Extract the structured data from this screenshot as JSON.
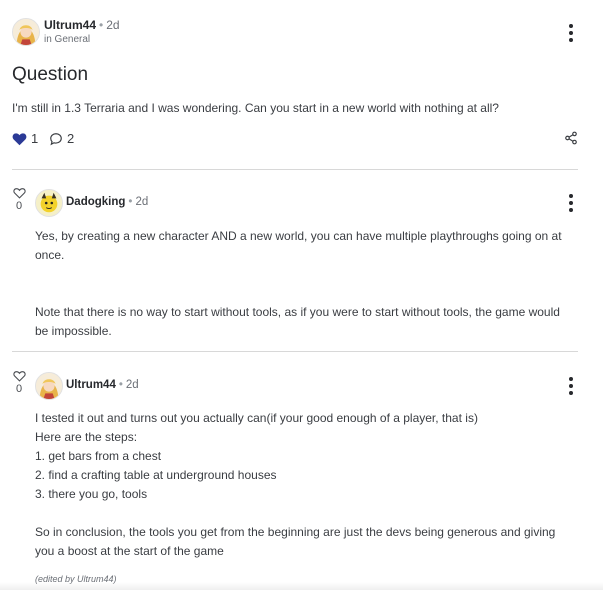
{
  "post": {
    "author": "Ultrum44",
    "separator": "•",
    "time": "2d",
    "category": "in General",
    "title": "Question",
    "body": "I'm still in 1.3 Terraria and I was wondering. Can you start in a new world with nothing at all?",
    "likes": "1",
    "comments": "2"
  },
  "comments": [
    {
      "votes": "0",
      "author": "Dadogking",
      "separator": "•",
      "time": "2d",
      "lines": [
        "Yes, by creating a new character AND a new world, you can have multiple playthroughs going on at",
        "once.",
        "Note that there is no way to start without tools, as if you were to start without tools, the game would",
        "be impossible."
      ]
    },
    {
      "votes": "0",
      "author": "Ultrum44",
      "separator": "•",
      "time": "2d",
      "lines": [
        "I tested it out and turns out you actually can(if your good enough of a player, that is)",
        "Here are the steps:",
        "1. get bars from a chest",
        "2. find a crafting table at underground houses",
        "3. there you go, tools",
        "So in conclusion, the tools you get from the beginning are just the devs being generous and giving",
        "you a boost at the start of the game"
      ],
      "edited": "(edited by Ultrum44)"
    }
  ],
  "colors": {
    "heart": "#2b3a96",
    "text": "#27292d",
    "muted": "#6b6f76",
    "divider": "#d8d8d8"
  },
  "icons": [
    "kebab-menu-icon",
    "heart-icon",
    "comment-bubble-icon",
    "share-icon",
    "heart-outline-icon"
  ]
}
